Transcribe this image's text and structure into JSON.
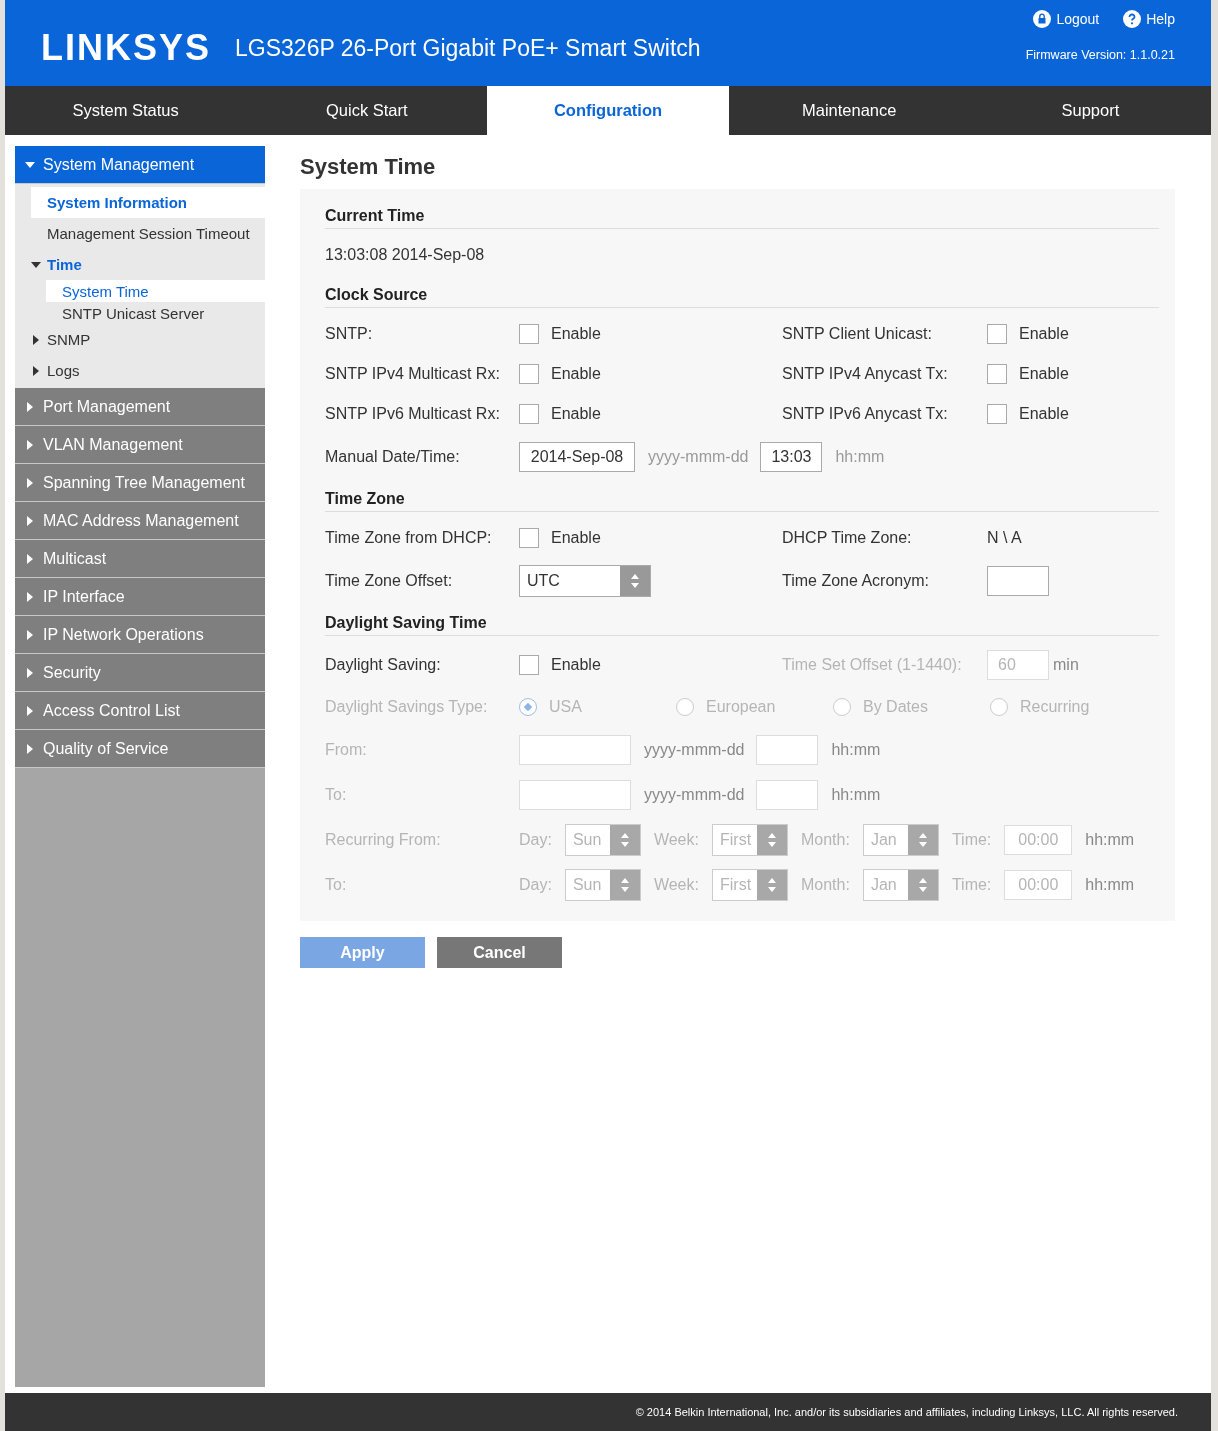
{
  "header": {
    "logo": "LINKSYS",
    "product": "LGS326P 26-Port Gigabit PoE+ Smart Switch",
    "links": [
      {
        "kind": "logout",
        "label": "Logout"
      },
      {
        "kind": "help",
        "label": "Help"
      }
    ],
    "firmware": "Firmware Version: 1.1.0.21"
  },
  "tabs": [
    {
      "label": "System Status",
      "selected": false
    },
    {
      "label": "Quick Start",
      "selected": false
    },
    {
      "label": "Configuration",
      "selected": true
    },
    {
      "label": "Maintenance",
      "selected": false
    },
    {
      "label": "Support",
      "selected": false
    }
  ],
  "sidebar": [
    {
      "label": "System Management",
      "expanded": true,
      "children": [
        {
          "label": "System Information",
          "selected": true
        },
        {
          "label": "Management Session Timeout",
          "selected": false
        },
        {
          "label": "Time",
          "selected": true,
          "expanded": true,
          "children": [
            {
              "label": "System Time",
              "selected": true
            },
            {
              "label": "SNTP Unicast Server",
              "selected": false
            }
          ]
        },
        {
          "label": "SNMP",
          "selected": false,
          "expanded": false
        },
        {
          "label": "Logs",
          "selected": false,
          "expanded": false
        }
      ]
    },
    {
      "label": "Port Management",
      "expanded": false
    },
    {
      "label": "VLAN Management",
      "expanded": false
    },
    {
      "label": "Spanning Tree Management",
      "expanded": false
    },
    {
      "label": "MAC Address Management",
      "expanded": false
    },
    {
      "label": "Multicast",
      "expanded": false
    },
    {
      "label": "IP Interface",
      "expanded": false
    },
    {
      "label": "IP Network Operations",
      "expanded": false
    },
    {
      "label": "Security",
      "expanded": false
    },
    {
      "label": "Access Control List",
      "expanded": false
    },
    {
      "label": "Quality of Service",
      "expanded": false
    }
  ],
  "page_title": "System Time",
  "sections": [
    {
      "title": "Current Time",
      "rows": [
        [
          {
            "kind": "text",
            "value": "13:03:08 2014-Sep-08",
            "disabled": false
          }
        ]
      ]
    },
    {
      "title": "Clock Source",
      "rows": [
        [
          {
            "label": "SNTP:",
            "kind": "checkbox",
            "option": "Enable",
            "checked": false,
            "disabled": false
          },
          {
            "label": "SNTP Client Unicast:",
            "kind": "checkbox",
            "option": "Enable",
            "checked": false,
            "disabled": false
          }
        ],
        [
          {
            "label": "SNTP IPv4 Multicast Rx:",
            "kind": "checkbox",
            "option": "Enable",
            "checked": false,
            "disabled": false
          },
          {
            "label": "SNTP IPv4 Anycast Tx:",
            "kind": "checkbox",
            "option": "Enable",
            "checked": false,
            "disabled": false
          }
        ],
        [
          {
            "label": "SNTP IPv6 Multicast Rx:",
            "kind": "checkbox",
            "option": "Enable",
            "checked": false,
            "disabled": false
          },
          {
            "label": "SNTP IPv6 Anycast Tx:",
            "kind": "checkbox",
            "option": "Enable",
            "checked": false,
            "disabled": false
          }
        ],
        [
          {
            "label": "Manual Date/Time:",
            "kind": "datetime",
            "date": "2014-Sep-08",
            "date_format": "yyyy-mmm-dd",
            "time": "13:03",
            "time_format": "hh:mm",
            "disabled": false
          }
        ]
      ]
    },
    {
      "title": "Time Zone",
      "rows": [
        [
          {
            "label": "Time Zone from DHCP:",
            "kind": "checkbox",
            "option": "Enable",
            "checked": false,
            "disabled": false
          },
          {
            "label": "DHCP Time Zone:",
            "kind": "text",
            "value": "N \\ A",
            "disabled": false
          }
        ],
        [
          {
            "label": "Time Zone Offset:",
            "kind": "select",
            "value": "UTC",
            "disabled": false
          },
          {
            "label": "Time Zone Acronym:",
            "kind": "input",
            "disabled": false
          }
        ]
      ]
    },
    {
      "title": "Daylight Saving Time",
      "rows": [
        [
          {
            "label": "Daylight Saving:",
            "kind": "checkbox",
            "option": "Enable",
            "checked": false,
            "disabled": false
          },
          {
            "label": "Time Set Offset (1-1440):",
            "kind": "input",
            "value": "60",
            "unit": "min",
            "disabled": true
          }
        ],
        [
          {
            "label": "Daylight Savings Type:",
            "kind": "radio",
            "disabled": true,
            "options": [
              {
                "label": "USA",
                "selected": true
              },
              {
                "label": "European",
                "selected": false
              },
              {
                "label": "By Dates",
                "selected": false
              },
              {
                "label": "Recurring",
                "selected": false
              }
            ]
          }
        ],
        [
          {
            "label": "From:",
            "kind": "datetime",
            "date_format": "yyyy-mmm-dd",
            "time_format": "hh:mm",
            "disabled": true
          }
        ],
        [
          {
            "label": "To:",
            "kind": "datetime",
            "date_format": "yyyy-mmm-dd",
            "time_format": "hh:mm",
            "disabled": true
          }
        ],
        [
          {
            "label": "Recurring From:",
            "kind": "recurring",
            "disabled": true,
            "parts": [
              {
                "label": "Day:",
                "value": "Sun"
              },
              {
                "label": "Week:",
                "value": "First"
              },
              {
                "label": "Month:",
                "value": "Jan"
              }
            ],
            "time_label": "Time:",
            "time": "00:00",
            "time_format": "hh:mm"
          }
        ],
        [
          {
            "label": "To:",
            "kind": "recurring",
            "disabled": true,
            "parts": [
              {
                "label": "Day:",
                "value": "Sun"
              },
              {
                "label": "Week:",
                "value": "First"
              },
              {
                "label": "Month:",
                "value": "Jan"
              }
            ],
            "time_label": "Time:",
            "time": "00:00",
            "time_format": "hh:mm"
          }
        ]
      ]
    }
  ],
  "buttons": [
    {
      "label": "Apply",
      "kind": "primary"
    },
    {
      "label": "Cancel",
      "kind": "secondary"
    }
  ],
  "footer": "© 2014 Belkin International, Inc. and/or its subsidiaries and affiliates, including Linksys, LLC. All rights reserved."
}
